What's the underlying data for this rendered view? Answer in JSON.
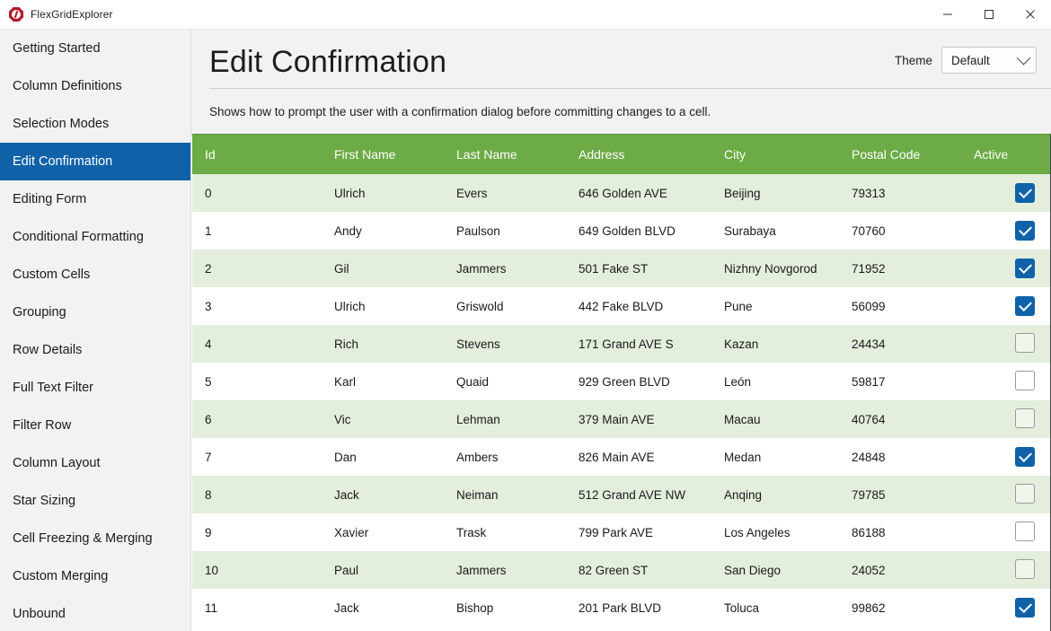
{
  "window": {
    "title": "FlexGridExplorer",
    "icon": "app-logo-icon",
    "minimize_label": "—",
    "maximize_label": "☐",
    "close_label": "✕"
  },
  "sidebar": {
    "items": [
      {
        "label": "Getting Started",
        "active": false
      },
      {
        "label": "Column Definitions",
        "active": false
      },
      {
        "label": "Selection Modes",
        "active": false
      },
      {
        "label": "Edit Confirmation",
        "active": true
      },
      {
        "label": "Editing Form",
        "active": false
      },
      {
        "label": "Conditional Formatting",
        "active": false
      },
      {
        "label": "Custom Cells",
        "active": false
      },
      {
        "label": "Grouping",
        "active": false
      },
      {
        "label": "Row Details",
        "active": false
      },
      {
        "label": "Full Text Filter",
        "active": false
      },
      {
        "label": "Filter Row",
        "active": false
      },
      {
        "label": "Column Layout",
        "active": false
      },
      {
        "label": "Star Sizing",
        "active": false
      },
      {
        "label": "Cell Freezing & Merging",
        "active": false
      },
      {
        "label": "Custom Merging",
        "active": false
      },
      {
        "label": "Unbound",
        "active": false
      }
    ]
  },
  "page": {
    "title": "Edit Confirmation",
    "description": "Shows how to prompt the user with a confirmation dialog before committing changes to a cell."
  },
  "theme": {
    "label": "Theme",
    "selected": "Default"
  },
  "colors": {
    "header_green": "#6cab46",
    "row_alt_green": "#e3eedd",
    "accent_blue": "#0f62a8",
    "sidebar_bg": "#f2f2f2",
    "app_icon_red": "#b01a28"
  },
  "grid": {
    "columns": [
      {
        "key": "id",
        "label": "Id"
      },
      {
        "key": "first",
        "label": "First Name"
      },
      {
        "key": "last",
        "label": "Last Name"
      },
      {
        "key": "address",
        "label": "Address"
      },
      {
        "key": "city",
        "label": "City"
      },
      {
        "key": "postal",
        "label": "Postal Code"
      },
      {
        "key": "active",
        "label": "Active"
      }
    ],
    "rows": [
      {
        "id": "0",
        "first": "Ulrich",
        "last": "Evers",
        "address": "646 Golden AVE",
        "city": "Beijing",
        "postal": "79313",
        "active": true
      },
      {
        "id": "1",
        "first": "Andy",
        "last": "Paulson",
        "address": "649 Golden BLVD",
        "city": "Surabaya",
        "postal": "70760",
        "active": true
      },
      {
        "id": "2",
        "first": "Gil",
        "last": "Jammers",
        "address": "501 Fake ST",
        "city": "Nizhny Novgorod",
        "postal": "71952",
        "active": true
      },
      {
        "id": "3",
        "first": "Ulrich",
        "last": "Griswold",
        "address": "442 Fake BLVD",
        "city": "Pune",
        "postal": "56099",
        "active": true
      },
      {
        "id": "4",
        "first": "Rich",
        "last": "Stevens",
        "address": "171 Grand AVE S",
        "city": "Kazan",
        "postal": "24434",
        "active": false
      },
      {
        "id": "5",
        "first": "Karl",
        "last": "Quaid",
        "address": "929 Green BLVD",
        "city": "León",
        "postal": "59817",
        "active": false
      },
      {
        "id": "6",
        "first": "Vic",
        "last": "Lehman",
        "address": "379 Main AVE",
        "city": "Macau",
        "postal": "40764",
        "active": false
      },
      {
        "id": "7",
        "first": "Dan",
        "last": "Ambers",
        "address": "826 Main AVE",
        "city": "Medan",
        "postal": "24848",
        "active": true
      },
      {
        "id": "8",
        "first": "Jack",
        "last": "Neiman",
        "address": "512 Grand AVE NW",
        "city": "Anqing",
        "postal": "79785",
        "active": false
      },
      {
        "id": "9",
        "first": "Xavier",
        "last": "Trask",
        "address": "799 Park AVE",
        "city": "Los Angeles",
        "postal": "86188",
        "active": false
      },
      {
        "id": "10",
        "first": "Paul",
        "last": "Jammers",
        "address": "82 Green ST",
        "city": "San Diego",
        "postal": "24052",
        "active": false
      },
      {
        "id": "11",
        "first": "Jack",
        "last": "Bishop",
        "address": "201 Park BLVD",
        "city": "Toluca",
        "postal": "99862",
        "active": true
      }
    ]
  }
}
